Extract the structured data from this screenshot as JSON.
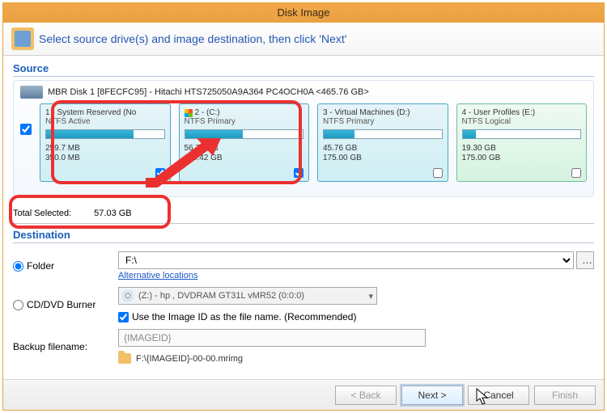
{
  "window": {
    "title": "Disk Image"
  },
  "instruction": "Select source drive(s) and image destination, then click 'Next'",
  "source": {
    "heading": "Source",
    "disk_label": "MBR Disk 1 [8FECFC95] - Hitachi HTS725050A9A364 PC4OCH0A  <465.76 GB>",
    "all_checked": true,
    "partitions": [
      {
        "title": "1 - System Reserved (No",
        "fs": "NTFS Active",
        "used": "259.7 MB",
        "capacity": "350.0 MB",
        "fill_pct": 74,
        "checked": true,
        "green": false,
        "winicon": false
      },
      {
        "title": "2 -  (C:)",
        "fs": "NTFS Primary",
        "used": "56.77 GB",
        "capacity": "115.42 GB",
        "fill_pct": 49,
        "checked": true,
        "green": false,
        "winicon": true
      },
      {
        "title": "3 - Virtual Machines (D:)",
        "fs": "NTFS Primary",
        "used": "45.76 GB",
        "capacity": "175.00 GB",
        "fill_pct": 26,
        "checked": false,
        "green": false,
        "winicon": false
      },
      {
        "title": "4 - User Profiles (E:)",
        "fs": "NTFS Logical",
        "used": "19.30 GB",
        "capacity": "175.00 GB",
        "fill_pct": 11,
        "checked": false,
        "green": true,
        "winicon": false
      }
    ]
  },
  "totals": {
    "label": "Total Selected:",
    "value": "57.03 GB"
  },
  "destination": {
    "heading": "Destination",
    "folder_radio": "Folder",
    "folder_path": "F:\\",
    "alt_link": "Alternative locations",
    "burner_radio": "CD/DVD Burner",
    "burner_device": "(Z:) - hp     , DVDRAM GT31L    vMR52 (0:0:0)",
    "use_imageid_label": "Use the Image ID as the file name.  (Recommended)",
    "use_imageid_checked": true,
    "backup_filename_label": "Backup filename:",
    "backup_filename_value": "{IMAGEID}",
    "result_path": "F:\\{IMAGEID}-00-00.mrimg"
  },
  "footer": {
    "back": "< Back",
    "next": "Next >",
    "cancel": "Cancel",
    "finish": "Finish"
  }
}
